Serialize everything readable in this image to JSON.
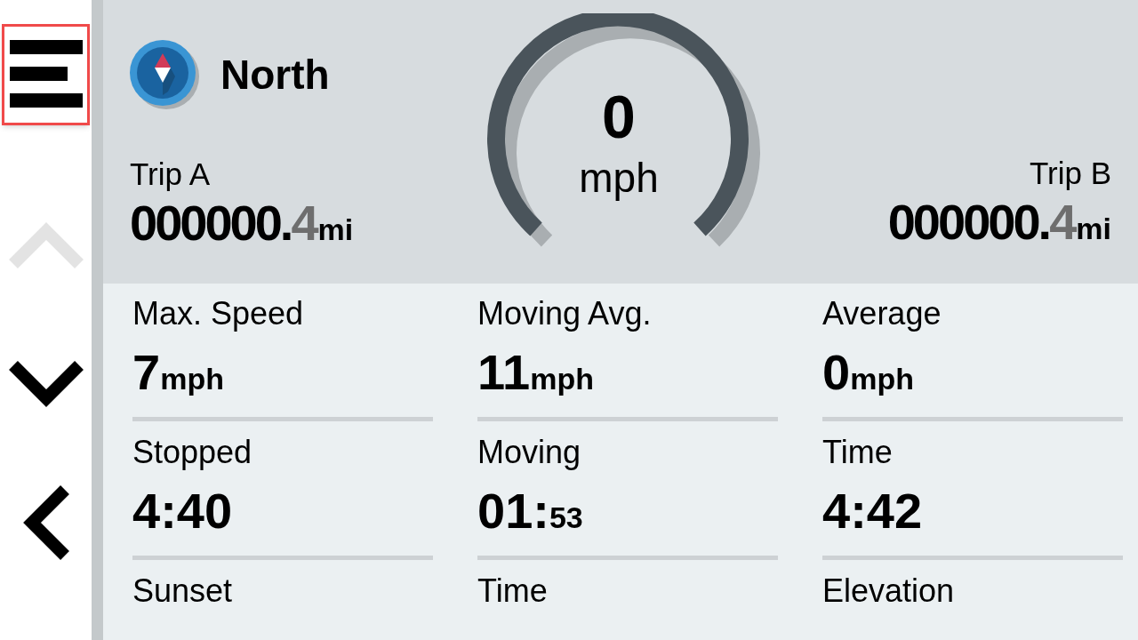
{
  "sidebar": {
    "buttons": [
      {
        "kind": "menu",
        "selected": true,
        "disabled": false
      },
      {
        "kind": "up",
        "selected": false,
        "disabled": true
      },
      {
        "kind": "down",
        "selected": false,
        "disabled": false
      },
      {
        "kind": "back",
        "selected": false,
        "disabled": false
      }
    ]
  },
  "heading": {
    "title": "North"
  },
  "speed": {
    "value": "0",
    "unit": "mph"
  },
  "trips": [
    {
      "label": "Trip A",
      "whole": "000000.",
      "fraction": "4",
      "unit": "mi"
    },
    {
      "label": "Trip B",
      "whole": "000000.",
      "fraction": "4",
      "unit": "mi"
    }
  ],
  "fields": [
    {
      "label": "Max. Speed",
      "value": "7",
      "unit": "mph"
    },
    {
      "label": "Moving Avg.",
      "value": "11",
      "unit": "mph"
    },
    {
      "label": "Average",
      "value": "0",
      "unit": "mph"
    },
    {
      "label": "Stopped",
      "value": "4:40"
    },
    {
      "label": "Moving",
      "value": "01:",
      "unit": "53"
    },
    {
      "label": "Time",
      "value": "4:42"
    },
    {
      "label": "Sunset"
    },
    {
      "label": "Time"
    },
    {
      "label": "Elevation"
    }
  ]
}
